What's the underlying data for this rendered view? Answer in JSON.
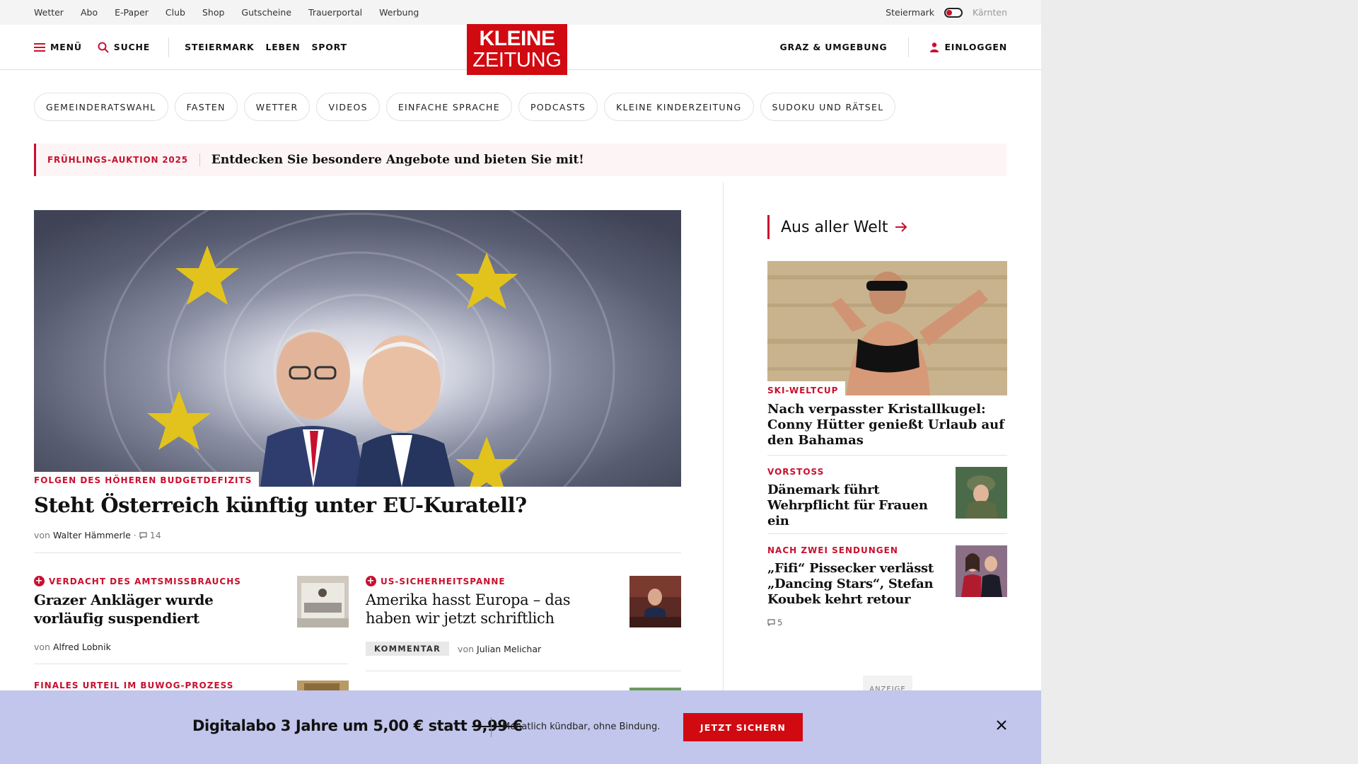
{
  "utility": {
    "links": [
      "Wetter",
      "Abo",
      "E-Paper",
      "Club",
      "Shop",
      "Gutscheine",
      "Trauerportal",
      "Werbung"
    ],
    "region_active": "Steiermark",
    "region_other": "Kärnten"
  },
  "header": {
    "menu_label": "MENÜ",
    "search_label": "SUCHE",
    "sections": [
      "STEIERMARK",
      "LEBEN",
      "SPORT"
    ],
    "logo_line1": "KLEINE",
    "logo_line2": "ZEITUNG",
    "region_label": "GRAZ & UMGEBUNG",
    "login_label": "EINLOGGEN",
    "brand_color": "#d10a11"
  },
  "topics": [
    "GEMEINDERATSWAHL",
    "FASTEN",
    "WETTER",
    "VIDEOS",
    "EINFACHE SPRACHE",
    "PODCASTS",
    "KLEINE KINDERZEITUNG",
    "SUDOKU UND RÄTSEL"
  ],
  "promo": {
    "kicker": "FRÜHLINGS-AUKTION 2025",
    "text": "Entdecken Sie besondere Angebote und bieten Sie mit!"
  },
  "hero": {
    "kicker": "FOLGEN DES HÖHEREN BUDGETDEFIZITS",
    "title": "Steht Österreich künftig unter EU-Kuratell?",
    "by": "von",
    "author": "Walter Hämmerle",
    "dot": "·",
    "comments": "14"
  },
  "articles": [
    {
      "kicker": "VERDACHT DES AMTSMISSBRAUCHS",
      "title_l1": "Grazer Ankläger wurde",
      "title_l2": "vorläufig suspendiert",
      "by": "von",
      "author": "Alfred Lobnik"
    },
    {
      "kicker": "US-SICHERHEITSPANNE",
      "title_l1": "Amerika hasst Europa – das",
      "title_l2": "haben wir jetzt schriftlich",
      "badge": "KOMMENTAR",
      "by": "von",
      "author": "Julian Melichar"
    },
    {
      "kicker": "FINALES URTEIL IM BUWOG-PROZESS"
    }
  ],
  "sidebar": {
    "heading": "Aus aller Welt",
    "lead": {
      "kicker": "SKI-WELTCUP",
      "title": "Nach verpasster Kristallkugel: Conny Hütter genießt Urlaub auf den Bahamas"
    },
    "items": [
      {
        "kicker": "VORSTOSS",
        "title": "Dänemark führt Wehrpflicht für Frauen ein"
      },
      {
        "kicker": "NACH ZWEI SENDUNGEN",
        "title": "„Fifi“ Pissecker verlässt „Dancing Stars“, Stefan Koubek kehrt retour",
        "comments": "5"
      }
    ],
    "ad_label": "ANZEIGE"
  },
  "offer": {
    "text": "Digitalabo 3 Jahre um 5,00 € statt",
    "old_price": "9,99 €",
    "sub": "Monatlich kündbar, ohne Bindung.",
    "cta": "JETZT SICHERN",
    "close_icon": "close-icon",
    "bg_color": "#c2c6ec"
  }
}
